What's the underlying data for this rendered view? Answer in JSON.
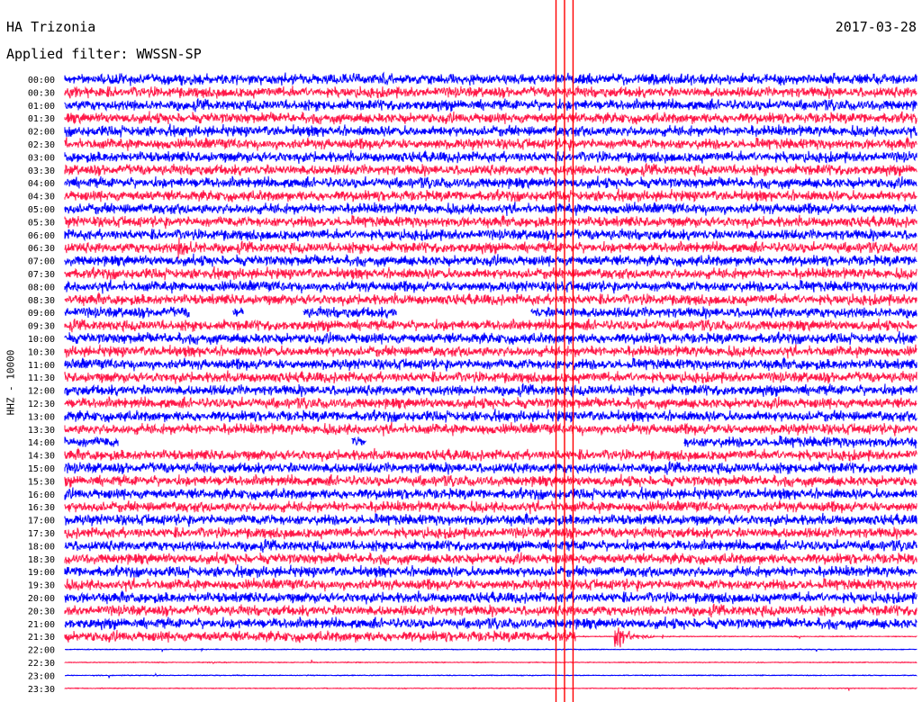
{
  "header": {
    "station": "HA Trizonia",
    "date": "2017-03-28",
    "filter": "Applied filter: WWSSN-SP"
  },
  "chart_data": {
    "type": "line",
    "title": "HA Trizonia",
    "subtitle": "Applied filter: WWSSN-SP",
    "date": "2017-03-28",
    "ylabel": "HHZ - 10000",
    "row_labels": [
      "00:00",
      "00:30",
      "01:00",
      "01:30",
      "02:00",
      "02:30",
      "03:00",
      "03:30",
      "04:00",
      "04:30",
      "05:00",
      "05:30",
      "06:00",
      "06:30",
      "07:00",
      "07:30",
      "08:00",
      "08:30",
      "09:00",
      "09:30",
      "10:00",
      "10:30",
      "11:00",
      "11:30",
      "12:00",
      "12:30",
      "13:00",
      "13:30",
      "14:00",
      "14:30",
      "15:00",
      "15:30",
      "16:00",
      "16:30",
      "17:00",
      "17:30",
      "18:00",
      "18:30",
      "19:00",
      "19:30",
      "20:00",
      "20:30",
      "21:00",
      "21:30",
      "22:00",
      "22:30",
      "23:00",
      "23:30"
    ],
    "row_colors": [
      "#0000ff",
      "#ff1a4a"
    ],
    "marker_color": "#ff0000",
    "row_duration_minutes": 30,
    "data_end_time": "21:48",
    "marker_offsets_minutes": [
      17.3,
      17.6,
      17.9
    ],
    "data_gaps": [
      {
        "row": "09:00",
        "from_min": 4.4,
        "to_min": 5.9
      },
      {
        "row": "09:00",
        "from_min": 6.3,
        "to_min": 8.4
      },
      {
        "row": "09:00",
        "from_min": 11.7,
        "to_min": 16.4
      },
      {
        "row": "14:00",
        "from_min": 1.9,
        "to_min": 10.1
      },
      {
        "row": "14:00",
        "from_min": 10.6,
        "to_min": 21.8
      }
    ],
    "events": [
      {
        "time": "06:30",
        "offset_min": 4.1,
        "amplitude": "moderate"
      },
      {
        "time": "21:30",
        "offset_min": 19.5,
        "amplitude": "large"
      }
    ],
    "noise_amplitude": "high"
  }
}
